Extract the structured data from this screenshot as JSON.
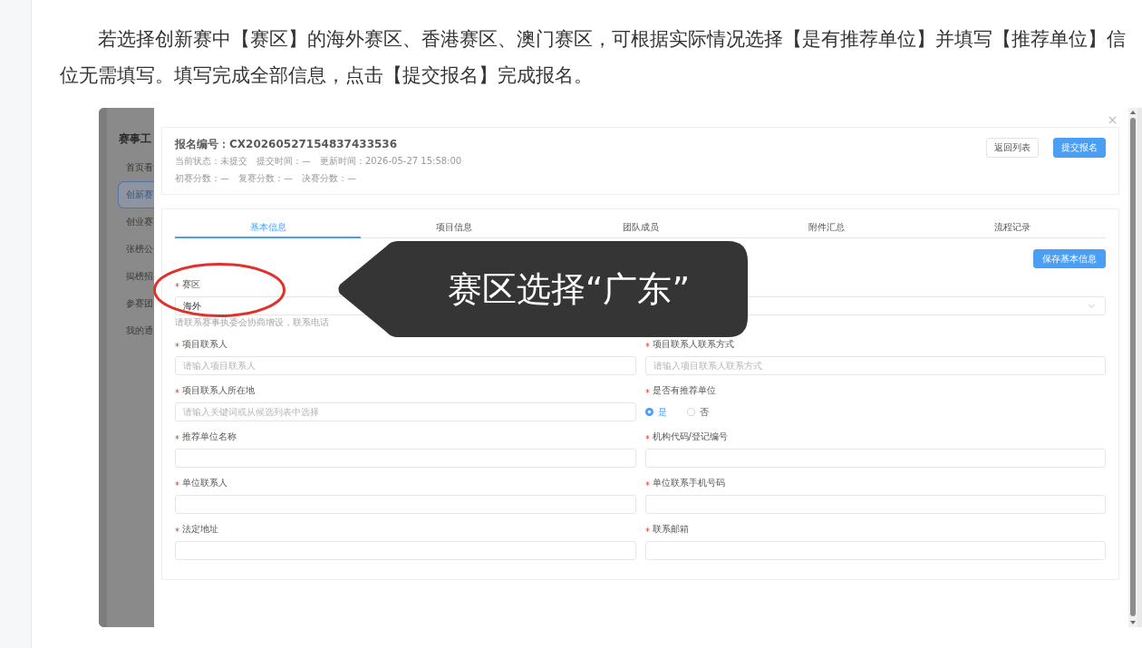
{
  "article": {
    "lines": [
      "若选择创新赛中【赛区】的海外赛区、香港赛区、澳门赛区，可根据实际情况选择【是有推荐单位】并填写【推荐单位】信",
      "位无需填写。填写完成全部信息，点击【提交报名】完成报名。"
    ]
  },
  "screenshot": {
    "sidebar": {
      "title": "赛事工",
      "items": [
        {
          "label": "首页看",
          "selected": false
        },
        {
          "label": "创新赛",
          "selected": true
        },
        {
          "label": "创业赛",
          "selected": false
        },
        {
          "label": "张榜公",
          "selected": false
        },
        {
          "label": "揭榜招",
          "selected": false
        },
        {
          "label": "参赛团",
          "selected": false
        },
        {
          "label": "我的通",
          "selected": false
        }
      ]
    },
    "modal": {
      "header": {
        "title": "报名编号：CX20260527154837433536",
        "meta_rows": [
          [
            "当前状态：未提交",
            "提交时间：—",
            "更新时间：2026-05-27 15:58:00"
          ],
          [
            "初赛分数：—",
            "复赛分数：—",
            "决赛分数：—"
          ]
        ],
        "buttons": [
          {
            "label": "返回列表",
            "kind": "secondary"
          },
          {
            "label": "提交报名",
            "kind": "primary"
          }
        ]
      },
      "tabs": [
        {
          "label": "基本信息",
          "selected": true
        },
        {
          "label": "项目信息",
          "selected": false
        },
        {
          "label": "团队成员",
          "selected": false
        },
        {
          "label": "附件汇总",
          "selected": false
        },
        {
          "label": "流程记录",
          "selected": false
        }
      ],
      "save_button": "保存基本信息",
      "region_field": {
        "label": "赛区",
        "required": true,
        "value": "海外",
        "hint": "请联系赛事执委会协商增设，联系电话"
      },
      "fields": [
        {
          "kind": "input",
          "label": "项目联系人",
          "required": true,
          "placeholder": "请输入项目联系人"
        },
        {
          "kind": "input",
          "label": "项目联系人联系方式",
          "required": true,
          "placeholder": "请输入项目联系人联系方式"
        },
        {
          "kind": "input",
          "label": "项目联系人所在地",
          "required": true,
          "placeholder": "请输入关键词或从候选列表中选择"
        },
        {
          "kind": "radio",
          "label": "是否有推荐单位",
          "required": true,
          "options": [
            {
              "label": "是",
              "selected": true
            },
            {
              "label": "否",
              "selected": false
            }
          ]
        },
        {
          "kind": "input",
          "label": "推荐单位名称",
          "required": true
        },
        {
          "kind": "input",
          "label": "机构代码/登记编号",
          "required": true
        },
        {
          "kind": "input",
          "label": "单位联系人",
          "required": true
        },
        {
          "kind": "input",
          "label": "单位联系手机号码",
          "required": true
        },
        {
          "kind": "input",
          "label": "法定地址",
          "required": true
        },
        {
          "kind": "input",
          "label": "联系邮箱",
          "required": true
        }
      ]
    },
    "callout": {
      "text": "赛区选择“广东”"
    }
  }
}
